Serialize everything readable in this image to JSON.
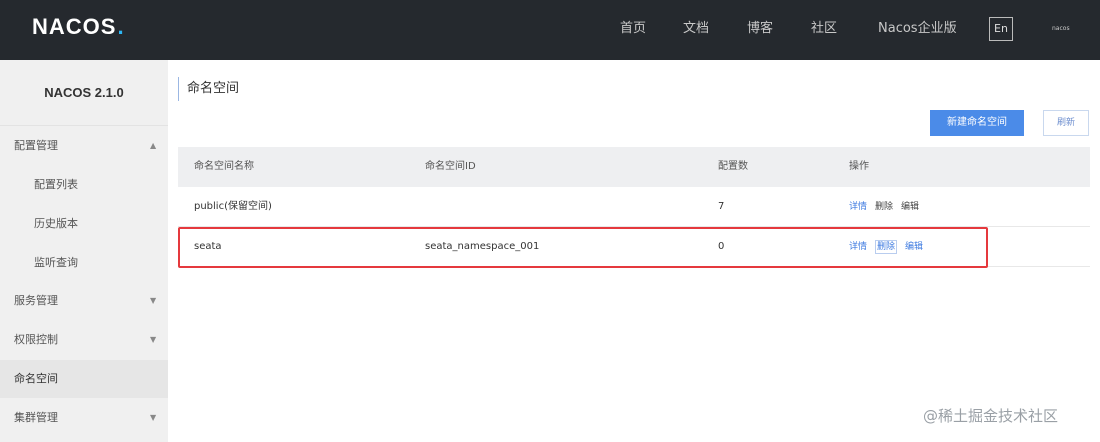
{
  "header": {
    "logo_text": "NACOS",
    "logo_dot": ".",
    "nav": [
      {
        "label": "首页"
      },
      {
        "label": "文档"
      },
      {
        "label": "博客"
      },
      {
        "label": "社区"
      },
      {
        "label": "Nacos企业版"
      }
    ],
    "lang_label": "En",
    "user_label": "nacos"
  },
  "sidebar": {
    "version": "NACOS 2.1.0",
    "items": [
      {
        "label": "配置管理",
        "icon": "chevron-up-icon"
      },
      {
        "label": "配置列表"
      },
      {
        "label": "历史版本"
      },
      {
        "label": "监听查询"
      },
      {
        "label": "服务管理",
        "icon": "chevron-down-icon"
      },
      {
        "label": "权限控制",
        "icon": "chevron-down-icon"
      },
      {
        "label": "命名空间"
      },
      {
        "label": "集群管理",
        "icon": "chevron-down-icon"
      }
    ]
  },
  "main": {
    "title": "命名空间",
    "create_button": "新建命名空间",
    "refresh_button": "刷新",
    "table": {
      "columns": [
        "命名空间名称",
        "命名空间ID",
        "配置数",
        "操作"
      ],
      "rows": [
        {
          "name": "public(保留空间)",
          "id": "",
          "count": "7",
          "ops": [
            "详情",
            "删除",
            "编辑"
          ]
        },
        {
          "name": "seata",
          "id": "seata_namespace_001",
          "count": "0",
          "ops": [
            "详情",
            "删除",
            "编辑"
          ]
        }
      ]
    }
  },
  "colors": {
    "header_bg": "#25292e",
    "primary": "#4b8be8",
    "highlight": "#e5393d"
  },
  "watermark": "@稀土掘金技术社区"
}
